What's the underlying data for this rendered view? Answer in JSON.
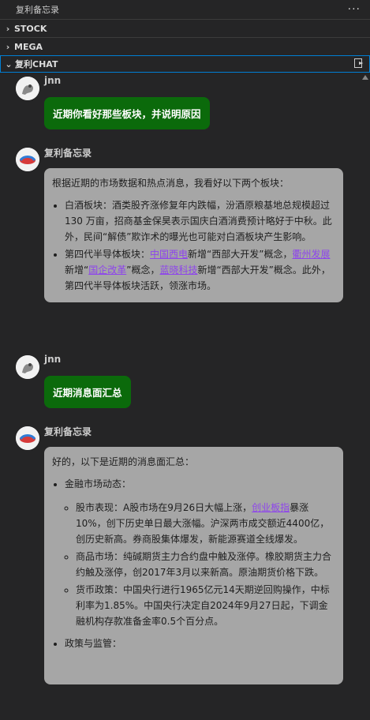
{
  "titlebar": {
    "title": "复利备忘录",
    "more": "···"
  },
  "sections": [
    {
      "label": "STOCK",
      "chevron": "›"
    },
    {
      "label": "MEGA",
      "chevron": "›"
    },
    {
      "label": "复利CHAT",
      "chevron": "⌄"
    }
  ],
  "messages": {
    "m1": {
      "author": "jnn",
      "text": "近期你看好那些板块，并说明原因"
    },
    "m2": {
      "author": "复利备忘录",
      "intro": "根据近期的市场数据和热点消息，我看好以下两个板块：",
      "item1": "白酒板块：酒类股齐涨修复年内跌幅，汾酒原粮基地总规模超过 130 万亩，招商基金保昊表示国庆白酒消费预计略好于中秋。此外，民间“解债”欺诈术的曝光也可能对白酒板块产生影响。",
      "item2": {
        "prefix": "第四代半导体板块：",
        "link1": "中国西电",
        "t1": "新增“西部大开发”概念，",
        "link2": "衢州发展",
        "t2": "新增“",
        "link3": "国企改革",
        "t3": "”概念，",
        "link4": "蓝晓科技",
        "t4": "新增“西部大开发”概念。此外，第四代半导体板块活跃，领涨市场。"
      }
    },
    "m3": {
      "author": "jnn",
      "text": "近期消息面汇总"
    },
    "m4": {
      "author": "复利备忘录",
      "intro": "好的，以下是近期的消息面汇总：",
      "group1": "金融市场动态：",
      "s1": {
        "prefix": "股市表现：A股市场在9月26日大幅上涨，",
        "link": "创业板指",
        "rest": "暴涨10%，创下历史单日最大涨幅。沪深两市成交额近4400亿，创历史新高。券商股集体爆发，新能源赛道全线爆发。"
      },
      "s2": "商品市场：纯碱期货主力合约盘中触及涨停。橡胶期货主力合约触及涨停，创2017年3月以来新高。原油期货价格下跌。",
      "s3": "货币政策：中国央行进行1965亿元14天期逆回购操作，中标利率为1.85%。中国央行决定自2024年9月27日起，下调金融机构存款准备金率0.5个百分点。",
      "group2": "政策与监管："
    }
  },
  "colors": {
    "user_bubble": "#0b6a0b",
    "bot_bubble": "#a6a6a6",
    "link": "#8e44ec",
    "focus_border": "#007fd4"
  }
}
